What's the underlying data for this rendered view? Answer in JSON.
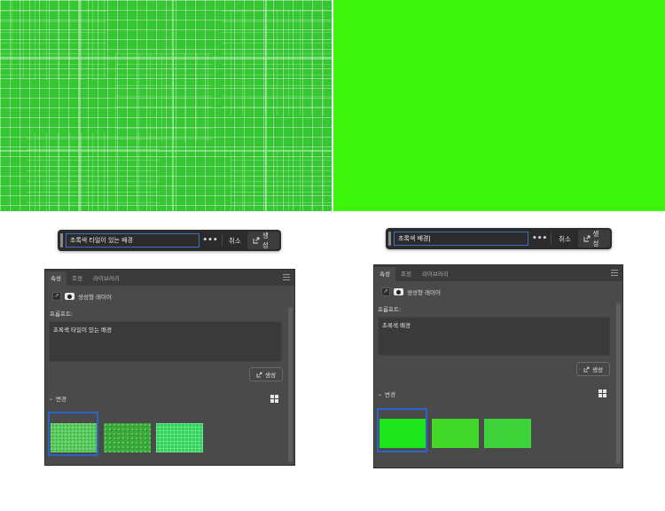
{
  "left": {
    "prompt_bar": {
      "input": "초록색 타일이 있는 배경",
      "more": "•••",
      "cancel": "취소",
      "generate": "생성"
    },
    "panel": {
      "tabs": [
        "속성",
        "조정",
        "라이브러리"
      ],
      "layer_name": "생성형 레이어",
      "prompt_label": "프롬프트:",
      "prompt_text": "초록색 타일이 있는 배경",
      "generate": "생성",
      "variations_label": "변경"
    },
    "colors": {
      "image": "#2fbe2c",
      "tile_lines": "#a8e8a4"
    }
  },
  "right": {
    "prompt_bar": {
      "input": "초록색 배경",
      "more": "•••",
      "cancel": "취소",
      "generate": "생성"
    },
    "panel": {
      "tabs": [
        "속성",
        "조정",
        "라이브러리"
      ],
      "layer_name": "생성형 레이어",
      "prompt_label": "프롬프트:",
      "prompt_text": "초록색 배경",
      "generate": "생성",
      "variations_label": "변경"
    },
    "colors": {
      "image": "#3cf50a"
    }
  },
  "icons": [
    "more-icon",
    "open-external-icon",
    "menu-icon",
    "chevron-down-icon",
    "grid-view-icon",
    "mask-icon",
    "layer-icon"
  ]
}
